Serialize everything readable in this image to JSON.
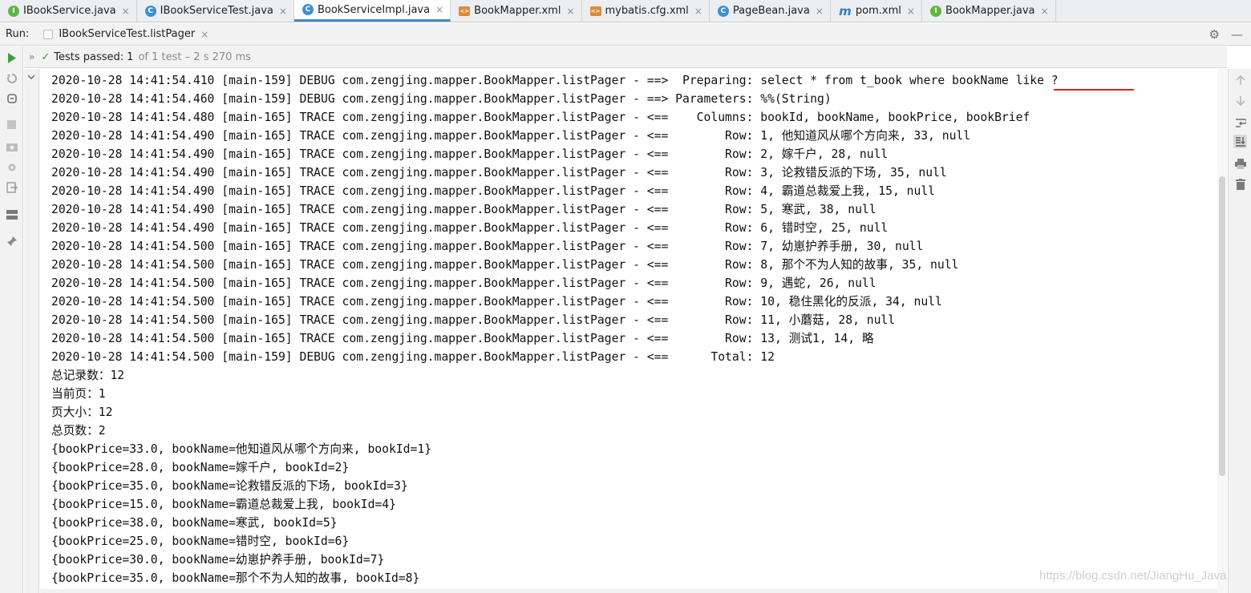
{
  "tabs": [
    {
      "label": "IBookService.java",
      "icon": "I",
      "kind": "interface",
      "active": false
    },
    {
      "label": "IBookServiceTest.java",
      "icon": "C",
      "kind": "test-class",
      "active": false
    },
    {
      "label": "BookServiceImpl.java",
      "icon": "C",
      "kind": "class",
      "active": true
    },
    {
      "label": "BookMapper.xml",
      "icon": "<>",
      "kind": "xml",
      "active": false
    },
    {
      "label": "mybatis.cfg.xml",
      "icon": "<>",
      "kind": "xml",
      "active": false
    },
    {
      "label": "PageBean.java",
      "icon": "C",
      "kind": "class",
      "active": false
    },
    {
      "label": "pom.xml",
      "icon": "m",
      "kind": "maven",
      "active": false
    },
    {
      "label": "BookMapper.java",
      "icon": "I",
      "kind": "interface",
      "active": false
    }
  ],
  "tab_close": "×",
  "run": {
    "label": "Run:",
    "config_name": "IBookServiceTest.listPager",
    "close": "×",
    "settings_icon": "⚙",
    "minimize_icon": "—"
  },
  "status": {
    "chevron": "»",
    "check": "✓",
    "passed_label": "Tests passed:",
    "passed_count": "1",
    "of_total": "of 1 test – 2 s 270 ms"
  },
  "console_lines": [
    "2020-10-28 14:41:54.410 [main-159] DEBUG com.zengjing.mapper.BookMapper.listPager - ==>  Preparing: select * from t_book where bookName like ?",
    "2020-10-28 14:41:54.460 [main-159] DEBUG com.zengjing.mapper.BookMapper.listPager - ==> Parameters: %%(String)",
    "2020-10-28 14:41:54.480 [main-165] TRACE com.zengjing.mapper.BookMapper.listPager - <==    Columns: bookId, bookName, bookPrice, bookBrief",
    "2020-10-28 14:41:54.490 [main-165] TRACE com.zengjing.mapper.BookMapper.listPager - <==        Row: 1, 他知道风从哪个方向来, 33, null",
    "2020-10-28 14:41:54.490 [main-165] TRACE com.zengjing.mapper.BookMapper.listPager - <==        Row: 2, 嫁千户, 28, null",
    "2020-10-28 14:41:54.490 [main-165] TRACE com.zengjing.mapper.BookMapper.listPager - <==        Row: 3, 论救错反派的下场, 35, null",
    "2020-10-28 14:41:54.490 [main-165] TRACE com.zengjing.mapper.BookMapper.listPager - <==        Row: 4, 霸道总裁爱上我, 15, null",
    "2020-10-28 14:41:54.490 [main-165] TRACE com.zengjing.mapper.BookMapper.listPager - <==        Row: 5, 寒武, 38, null",
    "2020-10-28 14:41:54.490 [main-165] TRACE com.zengjing.mapper.BookMapper.listPager - <==        Row: 6, 错时空, 25, null",
    "2020-10-28 14:41:54.500 [main-165] TRACE com.zengjing.mapper.BookMapper.listPager - <==        Row: 7, 幼崽护养手册, 30, null",
    "2020-10-28 14:41:54.500 [main-165] TRACE com.zengjing.mapper.BookMapper.listPager - <==        Row: 8, 那个不为人知的故事, 35, null",
    "2020-10-28 14:41:54.500 [main-165] TRACE com.zengjing.mapper.BookMapper.listPager - <==        Row: 9, 遇蛇, 26, null",
    "2020-10-28 14:41:54.500 [main-165] TRACE com.zengjing.mapper.BookMapper.listPager - <==        Row: 10, 稳住黑化的反派, 34, null",
    "2020-10-28 14:41:54.500 [main-165] TRACE com.zengjing.mapper.BookMapper.listPager - <==        Row: 11, 小蘑菇, 28, null",
    "2020-10-28 14:41:54.500 [main-165] TRACE com.zengjing.mapper.BookMapper.listPager - <==        Row: 13, 测试1, 14, 略",
    "2020-10-28 14:41:54.500 [main-159] DEBUG com.zengjing.mapper.BookMapper.listPager - <==      Total: 12",
    "总记录数：12",
    "当前页：1",
    "页大小：12",
    "总页数：2",
    "{bookPrice=33.0, bookName=他知道风从哪个方向来, bookId=1}",
    "{bookPrice=28.0, bookName=嫁千户, bookId=2}",
    "{bookPrice=35.0, bookName=论救错反派的下场, bookId=3}",
    "{bookPrice=15.0, bookName=霸道总裁爱上我, bookId=4}",
    "{bookPrice=38.0, bookName=寒武, bookId=5}",
    "{bookPrice=25.0, bookName=错时空, bookId=6}",
    "{bookPrice=30.0, bookName=幼崽护养手册, bookId=7}",
    "{bookPrice=35.0, bookName=那个不为人知的故事, bookId=8}"
  ],
  "left_toolbar_icons": [
    "rerun-icon",
    "rerun-failed-icon",
    "toggle-auto-test-icon",
    "stop-icon",
    "screenshot-icon",
    "settings-icon",
    "exit-icon",
    "layout-icon",
    "pin-icon"
  ],
  "right_toolbar_icons": [
    "up-arrow-icon",
    "down-arrow-icon",
    "soft-wrap-icon",
    "scroll-to-end-icon",
    "print-icon",
    "trash-icon"
  ],
  "watermark": "https://blog.csdn.net/JiangHu_Java",
  "colors": {
    "success_green": "#3e9d3e",
    "active_tab_underline": "#4a88c7",
    "annotation_red": "#e0201c"
  }
}
